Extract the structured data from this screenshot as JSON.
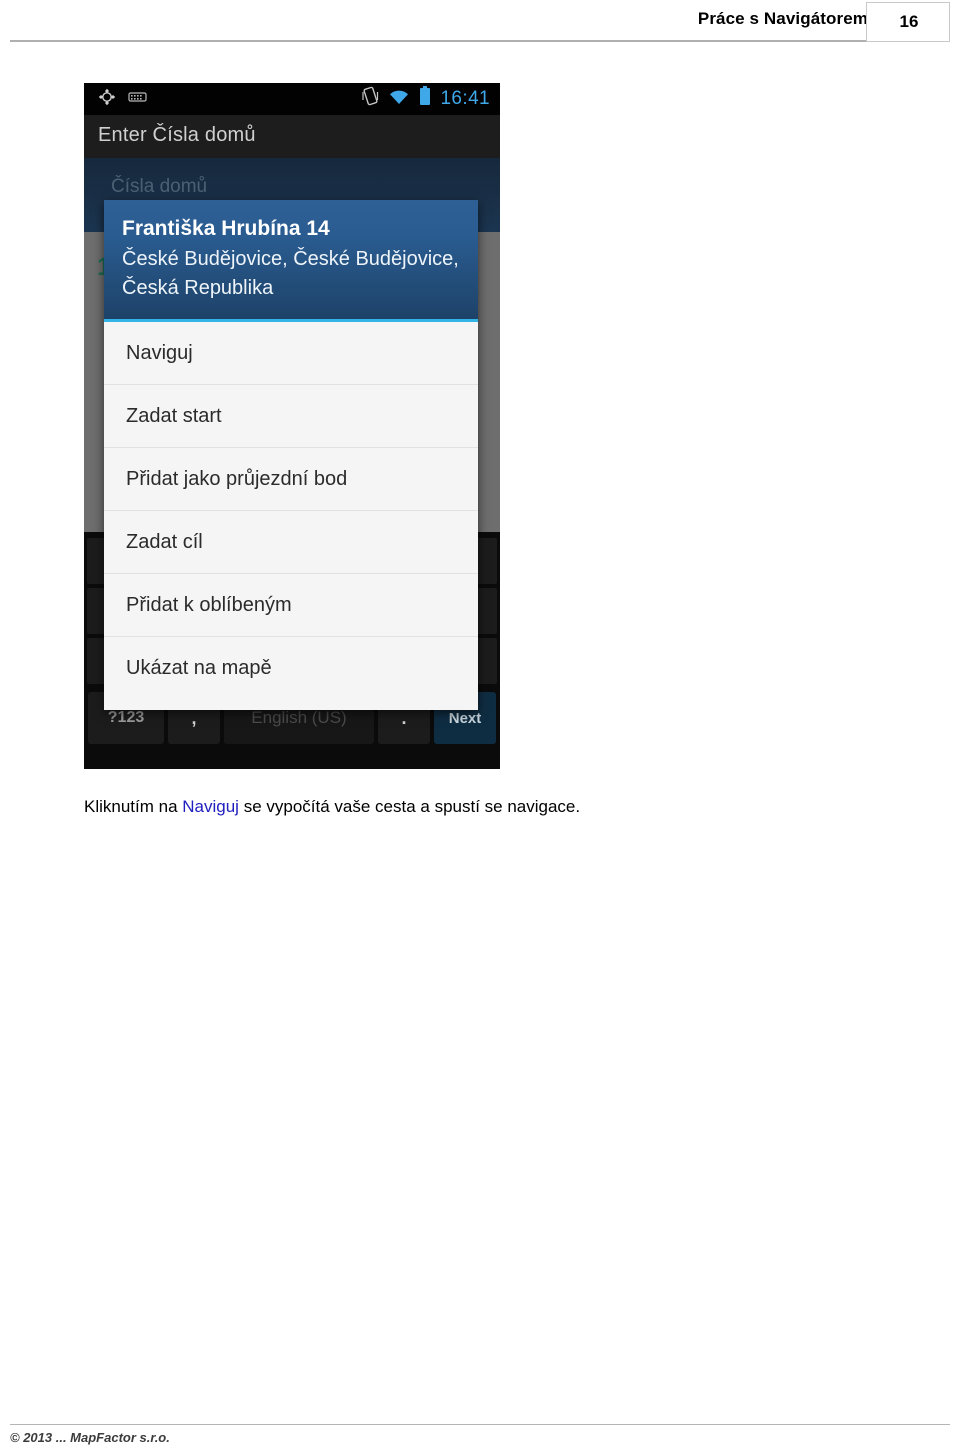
{
  "header": {
    "title": "Práce s Navigátorem",
    "page_number": "16"
  },
  "phone": {
    "status_bar": {
      "left_icons": [
        "gps-location-icon",
        "usb-debug-icon"
      ],
      "right_icons": [
        "vibrate-icon",
        "wifi-icon",
        "battery-icon"
      ],
      "clock": "16:41"
    },
    "action_bar": {
      "title": "Enter Čísla domů"
    },
    "form": {
      "hint": "Čísla domů",
      "result_index": "1"
    },
    "dialog": {
      "title": "Františka Hrubína 14",
      "subtitle": "České Budějovice, České Budějovice, Česká Republika",
      "items": [
        {
          "label": "Naviguj"
        },
        {
          "label": "Zadat start"
        },
        {
          "label": "Přidat jako průjezdní bod"
        },
        {
          "label": "Zadat cíl"
        },
        {
          "label": "Přidat k oblíbeným"
        },
        {
          "label": "Ukázat na mapě"
        }
      ]
    },
    "keyboard": {
      "symbols_key": "?123",
      "comma_key": ",",
      "space_key": "English (US)",
      "period_key": ".",
      "next_key": "Next"
    }
  },
  "caption": {
    "part1": "Kliknutím na ",
    "link": "Naviguj",
    "part2": " se vypočítá vaše cesta a spustí se navigace."
  },
  "footer": {
    "copyright": "© 2013 ... MapFactor s.r.o."
  },
  "colors": {
    "accent_blue": "#2e6096",
    "divider_cyan": "#34b5e8",
    "link": "#2020c0",
    "status_clock": "#3ea8e8"
  }
}
